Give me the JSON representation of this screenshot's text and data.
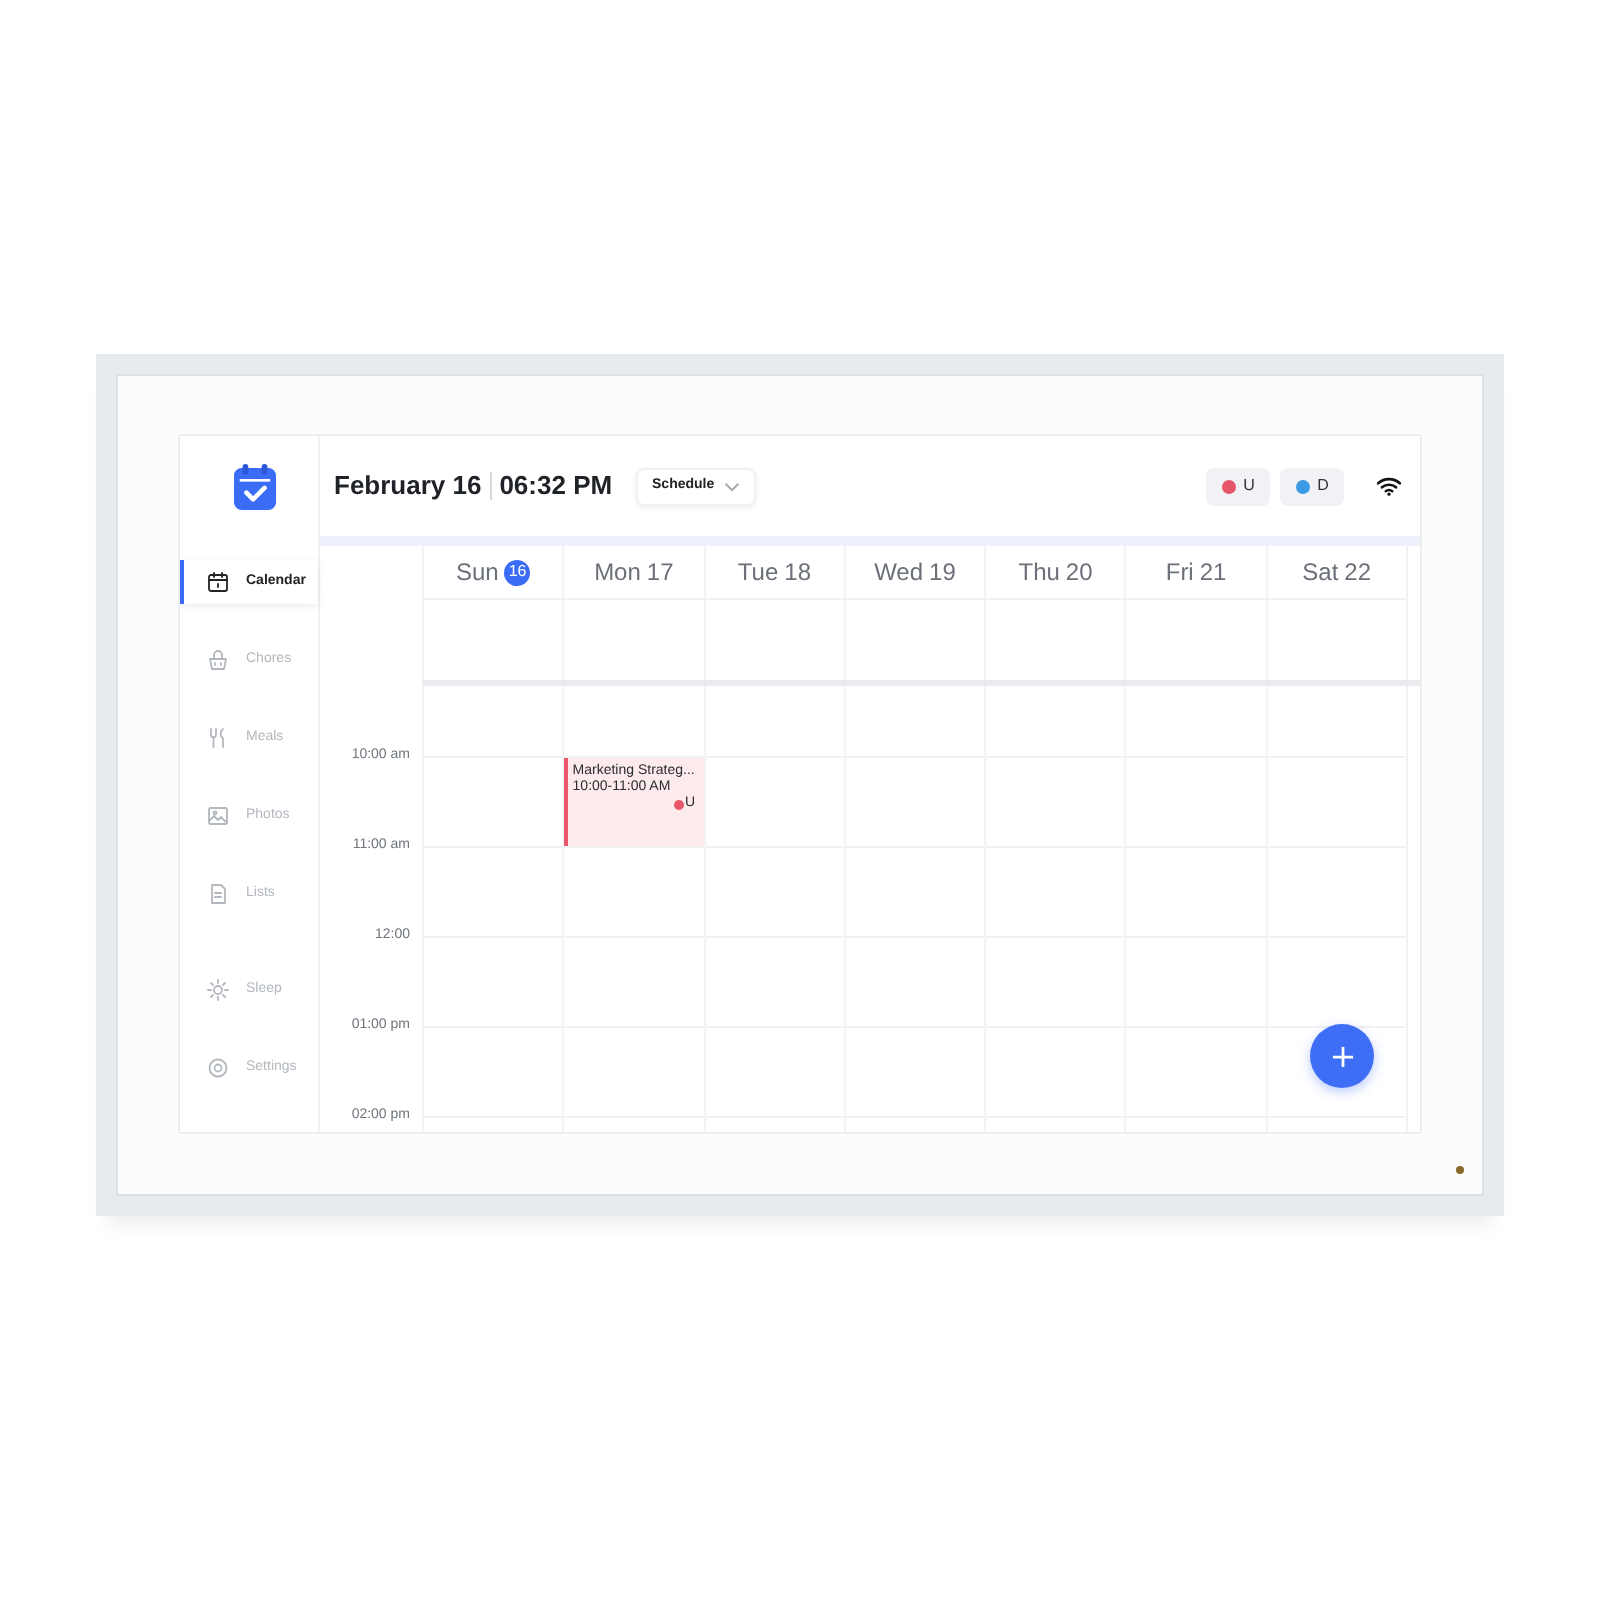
{
  "sidebar": {
    "items": [
      {
        "label": "Calendar",
        "selected": true
      },
      {
        "label": "Chores",
        "selected": false
      },
      {
        "label": "Meals",
        "selected": false
      },
      {
        "label": "Photos",
        "selected": false
      },
      {
        "label": "Lists",
        "selected": false
      }
    ],
    "bottom_items": [
      {
        "label": "Sleep",
        "selected": false
      },
      {
        "label": "Settings",
        "selected": false
      }
    ]
  },
  "header": {
    "date": "February 16",
    "time": "06:32 PM",
    "view_dropdown": {
      "value": "Schedule"
    },
    "profiles": [
      {
        "label": "U",
        "color": "#e8566a"
      },
      {
        "label": "D",
        "color": "#3b9ae1"
      }
    ]
  },
  "calendar": {
    "days": [
      {
        "weekday": "Sun",
        "date": "16",
        "today": true
      },
      {
        "weekday": "Mon",
        "date": "17",
        "today": false,
        "events": [
          {
            "title": "Marketing Strateg...",
            "time": "10:00-11:00 AM",
            "owner": "U",
            "color": "#e8566a"
          }
        ]
      },
      {
        "weekday": "Tue",
        "date": "18",
        "today": false
      },
      {
        "weekday": "Wed",
        "date": "19",
        "today": false
      },
      {
        "weekday": "Thu",
        "date": "20",
        "today": false
      },
      {
        "weekday": "Fri",
        "date": "21",
        "today": false
      },
      {
        "weekday": "Sat",
        "date": "22",
        "today": false
      }
    ],
    "time_labels": [
      "10:00 am",
      "11:00 am",
      "12:00",
      "01:00 pm",
      "02:00 pm"
    ]
  }
}
